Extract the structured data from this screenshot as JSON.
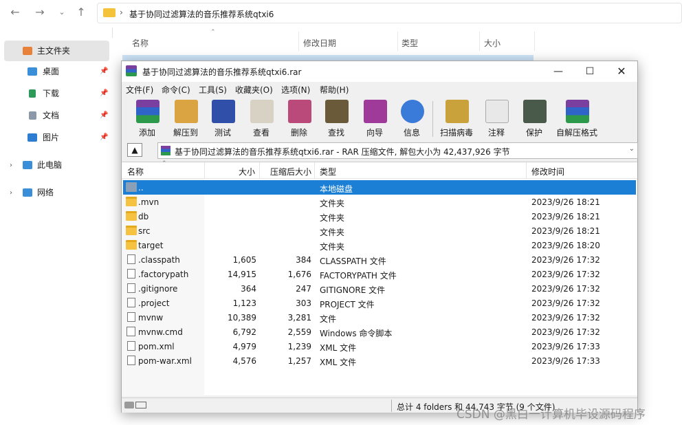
{
  "explorer": {
    "address_path": "基于协同过滤算法的音乐推荐系统qtxi6",
    "columns": {
      "name": "名称",
      "modified": "修改日期",
      "type": "类型",
      "size": "大小"
    },
    "sidebar": {
      "home": "主文件夹",
      "desktop": "桌面",
      "downloads": "下载",
      "documents": "文档",
      "pictures": "图片",
      "this_pc": "此电脑",
      "network": "网络"
    }
  },
  "rar": {
    "window_title": "基于协同过滤算法的音乐推荐系统qtxi6.rar",
    "menu": [
      "文件(F)",
      "命令(C)",
      "工具(S)",
      "收藏夹(O)",
      "选项(N)",
      "帮助(H)"
    ],
    "toolbar": [
      "添加",
      "解压到",
      "测试",
      "查看",
      "删除",
      "查找",
      "向导",
      "信息",
      "扫描病毒",
      "注释",
      "保护",
      "自解压格式"
    ],
    "path_text": "基于协同过滤算法的音乐推荐系统qtxi6.rar - RAR 压缩文件, 解包大小为 42,437,926 字节",
    "list_headers": {
      "name": "名称",
      "size": "大小",
      "packed": "压缩后大小",
      "type": "类型",
      "modified": "修改时间"
    },
    "rows": [
      {
        "name": "..",
        "size": "",
        "packed": "",
        "type": "本地磁盘",
        "date": "",
        "icon": "updir"
      },
      {
        "name": ".mvn",
        "size": "",
        "packed": "",
        "type": "文件夹",
        "date": "2023/9/26 18:21",
        "icon": "folder"
      },
      {
        "name": "db",
        "size": "",
        "packed": "",
        "type": "文件夹",
        "date": "2023/9/26 18:21",
        "icon": "folder"
      },
      {
        "name": "src",
        "size": "",
        "packed": "",
        "type": "文件夹",
        "date": "2023/9/26 18:21",
        "icon": "folder"
      },
      {
        "name": "target",
        "size": "",
        "packed": "",
        "type": "文件夹",
        "date": "2023/9/26 18:20",
        "icon": "folder"
      },
      {
        "name": ".classpath",
        "size": "1,605",
        "packed": "384",
        "type": "CLASSPATH 文件",
        "date": "2023/9/26 17:32",
        "icon": "file"
      },
      {
        "name": ".factorypath",
        "size": "14,915",
        "packed": "1,676",
        "type": "FACTORYPATH 文件",
        "date": "2023/9/26 17:32",
        "icon": "file"
      },
      {
        "name": ".gitignore",
        "size": "364",
        "packed": "247",
        "type": "GITIGNORE 文件",
        "date": "2023/9/26 17:32",
        "icon": "file"
      },
      {
        "name": ".project",
        "size": "1,123",
        "packed": "303",
        "type": "PROJECT 文件",
        "date": "2023/9/26 17:32",
        "icon": "file"
      },
      {
        "name": "mvnw",
        "size": "10,389",
        "packed": "3,281",
        "type": "文件",
        "date": "2023/9/26 17:32",
        "icon": "file"
      },
      {
        "name": "mvnw.cmd",
        "size": "6,792",
        "packed": "2,559",
        "type": "Windows 命令脚本",
        "date": "2023/9/26 17:32",
        "icon": "cmd"
      },
      {
        "name": "pom.xml",
        "size": "4,979",
        "packed": "1,239",
        "type": "XML 文件",
        "date": "2023/9/26 17:33",
        "icon": "file"
      },
      {
        "name": "pom-war.xml",
        "size": "4,576",
        "packed": "1,257",
        "type": "XML 文件",
        "date": "2023/9/26 17:33",
        "icon": "file"
      }
    ],
    "status": "总计 4 folders 和 44,743 字节 (9 个文件)"
  },
  "watermark": "CSDN @黑白一计算机毕设源码程序"
}
